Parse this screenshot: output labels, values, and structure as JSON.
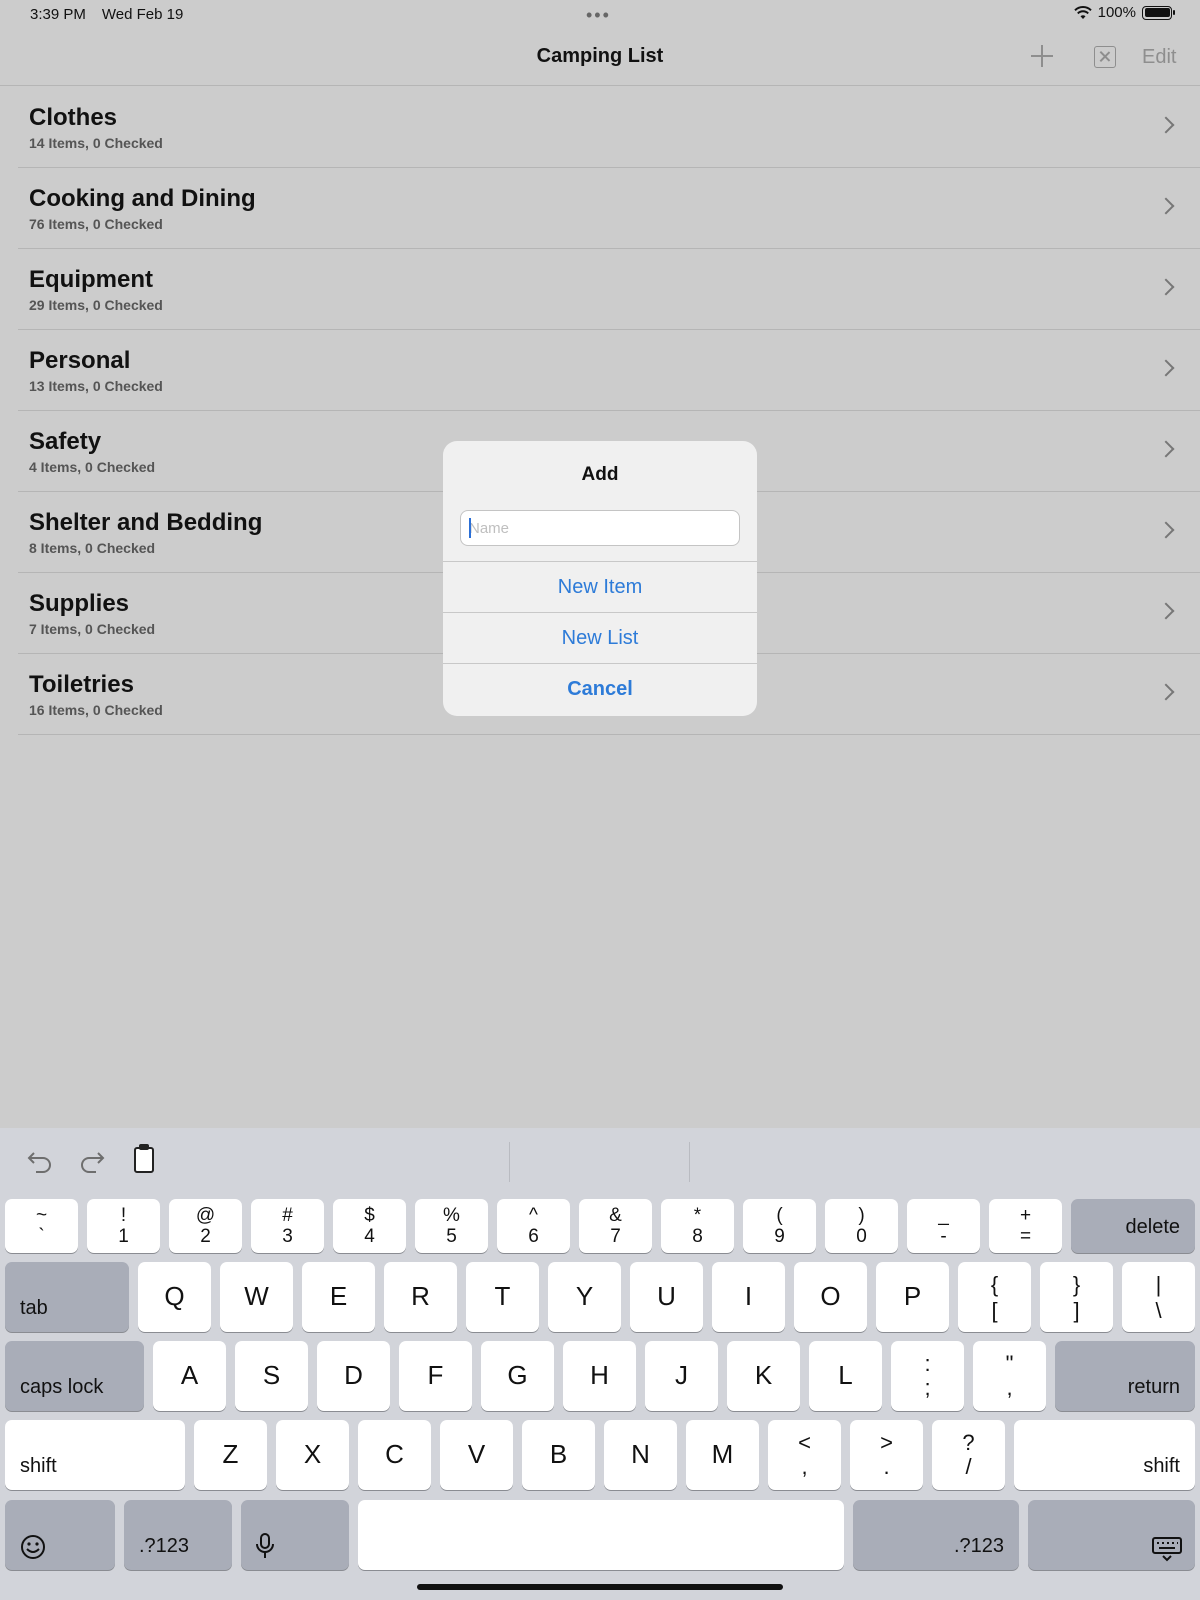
{
  "status": {
    "time": "3:39 PM",
    "date": "Wed Feb 19",
    "dots": "•••",
    "battery_text": "100%"
  },
  "nav": {
    "title": "Camping List",
    "edit_label": "Edit",
    "add_icon": "plus-icon",
    "close_icon": "close-square-icon"
  },
  "list": {
    "items": [
      {
        "title": "Clothes",
        "subtitle": "14 Items, 0 Checked"
      },
      {
        "title": "Cooking and Dining",
        "subtitle": "76 Items, 0 Checked"
      },
      {
        "title": "Equipment",
        "subtitle": "29 Items, 0 Checked"
      },
      {
        "title": "Personal",
        "subtitle": "13 Items, 0 Checked"
      },
      {
        "title": "Safety",
        "subtitle": "4 Items, 0 Checked"
      },
      {
        "title": "Shelter and Bedding",
        "subtitle": "8 Items, 0 Checked"
      },
      {
        "title": "Supplies",
        "subtitle": "7 Items, 0 Checked"
      },
      {
        "title": "Toiletries",
        "subtitle": "16 Items, 0 Checked"
      }
    ]
  },
  "dialog": {
    "title": "Add",
    "name_placeholder": "Name",
    "name_value": "",
    "new_item_label": "New Item",
    "new_list_label": "New List",
    "cancel_label": "Cancel"
  },
  "keyboard": {
    "toolbar": {
      "undo_icon": "undo-icon",
      "redo_icon": "redo-icon",
      "paste_icon": "clipboard-icon"
    },
    "row1": [
      {
        "up": "~",
        "down": "`"
      },
      {
        "up": "!",
        "down": "1"
      },
      {
        "up": "@",
        "down": "2"
      },
      {
        "up": "#",
        "down": "3"
      },
      {
        "up": "$",
        "down": "4"
      },
      {
        "up": "%",
        "down": "5"
      },
      {
        "up": "^",
        "down": "6"
      },
      {
        "up": "&",
        "down": "7"
      },
      {
        "up": "*",
        "down": "8"
      },
      {
        "up": "(",
        "down": "9"
      },
      {
        "up": ")",
        "down": "0"
      },
      {
        "up": "_",
        "down": "-"
      },
      {
        "up": "+",
        "down": "="
      }
    ],
    "delete_label": "delete",
    "tab_label": "tab",
    "row2": [
      "Q",
      "W",
      "E",
      "R",
      "T",
      "Y",
      "U",
      "I",
      "O",
      "P"
    ],
    "row2_sym": [
      {
        "up": "{",
        "down": "["
      },
      {
        "up": "}",
        "down": "]"
      },
      {
        "up": "|",
        "down": "\\"
      }
    ],
    "caps_label": "caps lock",
    "row3": [
      "A",
      "S",
      "D",
      "F",
      "G",
      "H",
      "J",
      "K",
      "L"
    ],
    "row3_sym": [
      {
        "up": ":",
        "down": ";"
      },
      {
        "up": "\"",
        "down": ","
      }
    ],
    "return_label": "return",
    "shift_label": "shift",
    "row4": [
      "Z",
      "X",
      "C",
      "V",
      "B",
      "N",
      "M"
    ],
    "row4_sym": [
      {
        "up": "<",
        "down": ","
      },
      {
        "up": ">",
        "down": "."
      },
      {
        "up": "?",
        "down": "/"
      }
    ],
    "numbers_label": ".?123",
    "emoji_icon": "emoji-icon",
    "mic_icon": "microphone-icon",
    "hide_icon": "keyboard-hide-icon"
  }
}
